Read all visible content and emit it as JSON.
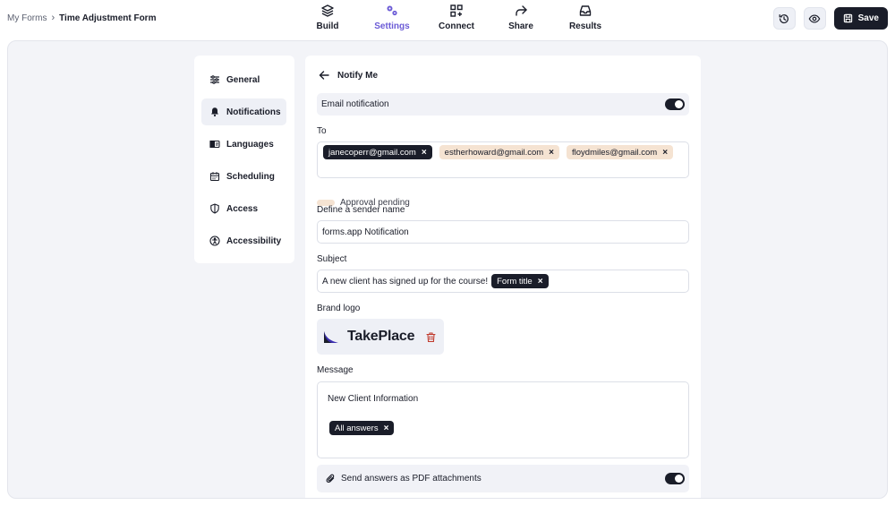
{
  "breadcrumb": {
    "root": "My Forms",
    "separator": "›",
    "current": "Time Adjustment Form"
  },
  "topnav": [
    {
      "label": "Build",
      "icon": "layers-icon",
      "active": false
    },
    {
      "label": "Settings",
      "icon": "gears-icon",
      "active": true
    },
    {
      "label": "Connect",
      "icon": "connect-grid-icon",
      "active": false
    },
    {
      "label": "Share",
      "icon": "share-arrow-icon",
      "active": false
    },
    {
      "label": "Results",
      "icon": "inbox-icon",
      "active": false
    }
  ],
  "actions": {
    "save_label": "Save",
    "history_icon": "history-icon",
    "preview_icon": "eye-icon",
    "save_icon": "save-disk-icon"
  },
  "colors": {
    "accent": "#6b5bd6",
    "dark": "#1a1d29",
    "pending": "#f5e3d2",
    "workspace_bg": "#f3f4f8"
  },
  "settings_menu": [
    {
      "label": "General",
      "icon": "sliders-icon"
    },
    {
      "label": "Notifications",
      "icon": "bell-icon",
      "active": true
    },
    {
      "label": "Languages",
      "icon": "language-icon"
    },
    {
      "label": "Scheduling",
      "icon": "calendar-icon"
    },
    {
      "label": "Access",
      "icon": "shield-icon"
    },
    {
      "label": "Accessibility",
      "icon": "accessibility-icon"
    }
  ],
  "panel": {
    "title": "Notify Me",
    "email_notification": {
      "label": "Email notification",
      "enabled": true
    },
    "to": {
      "label": "To",
      "recipients": [
        {
          "email": "janecoperr@gmail.com",
          "status": "confirmed"
        },
        {
          "email": "estherhoward@gmail.com",
          "status": "pending"
        },
        {
          "email": "floydmiles@gmail.com",
          "status": "pending"
        }
      ],
      "remove_glyph": "×"
    },
    "legend": {
      "label": "Approval pending"
    },
    "sender": {
      "label": "Define a sender name",
      "value": "forms.app Notification"
    },
    "subject": {
      "label": "Subject",
      "text": "A new client has signed up for the course!",
      "tag": "Form title"
    },
    "brand_logo": {
      "label": "Brand logo",
      "name": "TakePlace"
    },
    "message": {
      "label": "Message",
      "text": "New Client Information",
      "tag": "All answers"
    },
    "pdf": {
      "label": "Send answers as PDF attachments",
      "enabled": true
    }
  }
}
